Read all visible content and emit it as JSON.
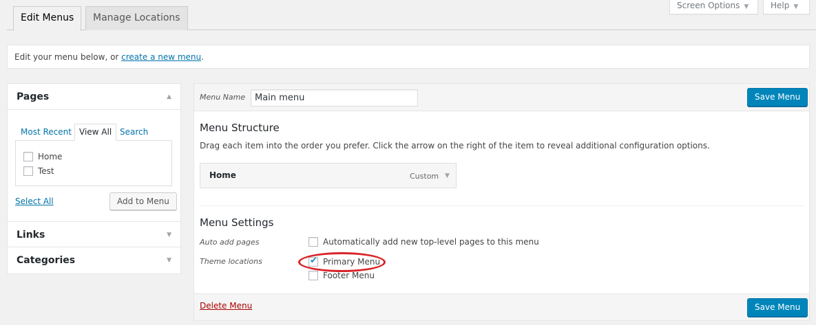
{
  "tabs": [
    {
      "label": "Edit Menus"
    },
    {
      "label": "Manage Locations"
    }
  ],
  "meta": {
    "screen_options": "Screen Options",
    "help": "Help"
  },
  "notice": {
    "text": "Edit your menu below, or ",
    "link": "create a new menu",
    "end": "."
  },
  "sidebar": {
    "pages_title": "Pages",
    "page_tabs": [
      "Most Recent",
      "View All",
      "Search"
    ],
    "pages": [
      "Home",
      "Test"
    ],
    "select_all": "Select All",
    "add_to_menu": "Add to Menu",
    "links_title": "Links",
    "categories_title": "Categories"
  },
  "menu": {
    "name_label": "Menu Name",
    "name_value": "Main menu",
    "save_label": "Save Menu",
    "structure_title": "Menu Structure",
    "structure_desc": "Drag each item into the order you prefer. Click the arrow on the right of the item to reveal additional configuration options.",
    "item": {
      "title": "Home",
      "type": "Custom"
    },
    "settings_title": "Menu Settings",
    "auto_add_label": "Auto add pages",
    "auto_add_text": "Automatically add new top-level pages to this menu",
    "theme_locations_label": "Theme locations",
    "locations": [
      {
        "label": "Primary Menu",
        "checked": true
      },
      {
        "label": "Footer Menu",
        "checked": false
      }
    ],
    "delete_label": "Delete Menu"
  },
  "icons": {
    "collapse": "triangle-up-icon",
    "expand": "triangle-down-icon"
  },
  "colors": {
    "primary": "#0085ba",
    "link": "#0073aa",
    "danger": "#a00",
    "annotation": "#d9242a"
  }
}
